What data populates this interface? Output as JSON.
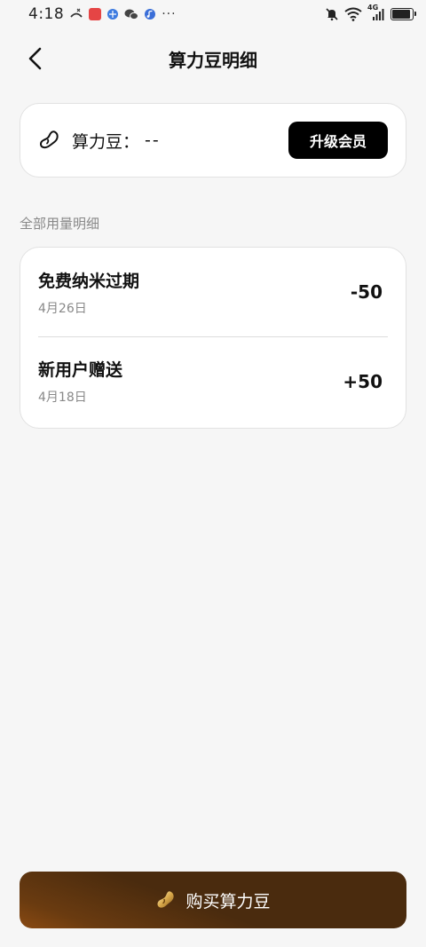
{
  "status_bar": {
    "time": "4:18",
    "network": "4G",
    "more": "···"
  },
  "header": {
    "title": "算力豆明细"
  },
  "balance": {
    "label": "算力豆：",
    "value": "--",
    "upgrade_label": "升级会员"
  },
  "section": {
    "label": "全部用量明细"
  },
  "records": [
    {
      "title": "免费纳米过期",
      "date": "4月26日",
      "amount": "-50"
    },
    {
      "title": "新用户赠送",
      "date": "4月18日",
      "amount": "+50"
    }
  ],
  "buy": {
    "label": "购买算力豆"
  },
  "colors": {
    "background": "#f6f6f6",
    "card": "#ffffff",
    "upgrade_button": "#000000",
    "buy_button": "#4a2b0e",
    "muted_text": "#888888"
  },
  "icons": {
    "back": "chevron-left-icon",
    "bean": "bean-icon",
    "buy": "gold-bean-icon",
    "wifi": "wifi-icon",
    "battery": "battery-icon",
    "mute": "bell-off-icon"
  },
  "battery_level": 0.9
}
